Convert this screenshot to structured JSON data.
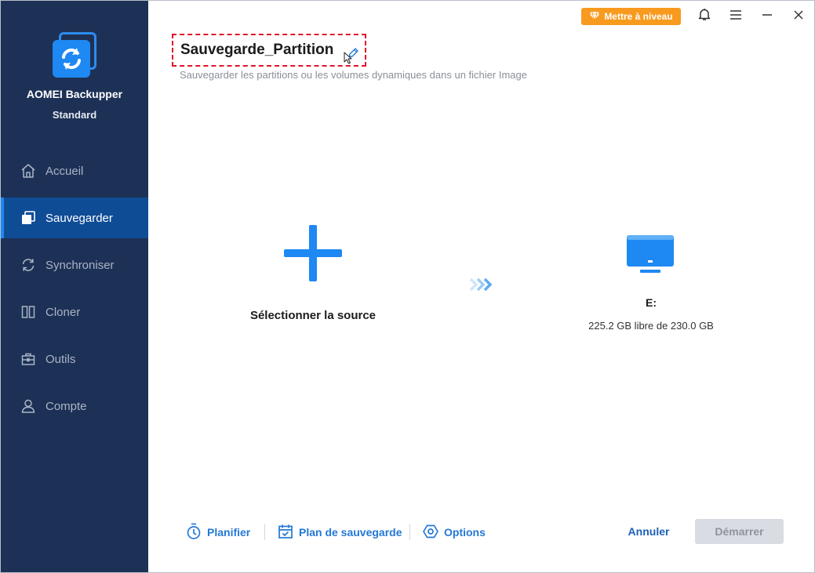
{
  "app": {
    "name": "AOMEI Backupper",
    "edition": "Standard"
  },
  "sidebar": {
    "items": [
      {
        "label": "Accueil",
        "icon": "home-icon",
        "active": false
      },
      {
        "label": "Sauvegarder",
        "icon": "backup-icon",
        "active": true
      },
      {
        "label": "Synchroniser",
        "icon": "sync-icon",
        "active": false
      },
      {
        "label": "Cloner",
        "icon": "clone-icon",
        "active": false
      },
      {
        "label": "Outils",
        "icon": "toolbox-icon",
        "active": false
      },
      {
        "label": "Compte",
        "icon": "user-icon",
        "active": false
      }
    ]
  },
  "topbar": {
    "upgrade_label": "Mettre à niveau",
    "icons": [
      "diamond-icon",
      "bell-icon",
      "menu-icon",
      "minimize-icon",
      "close-icon"
    ]
  },
  "task": {
    "title": "Sauvegarde_Partition",
    "subtitle": "Sauvegarder les partitions ou les volumes dynamiques dans un fichier Image"
  },
  "source": {
    "label": "Sélectionner la source"
  },
  "destination": {
    "name": "E:",
    "info": "225.2 GB libre de 230.0 GB"
  },
  "footer": {
    "schedule_label": "Planifier",
    "plan_label": "Plan de sauvegarde",
    "options_label": "Options",
    "cancel_label": "Annuler",
    "start_label": "Démarrer"
  },
  "colors": {
    "sidebar_bg": "#1d3156",
    "sidebar_active": "#0f4c96",
    "accent": "#1e88f3",
    "upgrade": "#f79a1e",
    "title_outline": "#e0142a"
  }
}
